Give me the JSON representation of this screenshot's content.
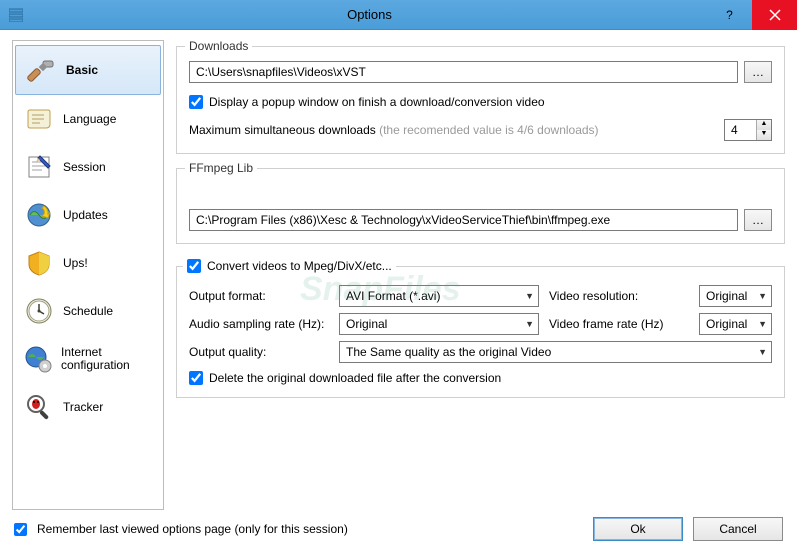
{
  "window": {
    "title": "Options",
    "help_tooltip": "?",
    "close_tooltip": "Close"
  },
  "sidebar": {
    "items": [
      {
        "label": "Basic"
      },
      {
        "label": "Language"
      },
      {
        "label": "Session"
      },
      {
        "label": "Updates"
      },
      {
        "label": "Ups!"
      },
      {
        "label": "Schedule"
      },
      {
        "label": "Internet configuration"
      },
      {
        "label": "Tracker"
      }
    ]
  },
  "downloads": {
    "legend": "Downloads",
    "path": "C:\\Users\\snapfiles\\Videos\\xVST",
    "popup_checked": true,
    "popup_label": "Display a popup window on finish a download/conversion video",
    "max_label": "Maximum simultaneous downloads",
    "max_hint": "(the recomended value is 4/6 downloads)",
    "max_value": "4"
  },
  "ffmpeg": {
    "legend": "FFmpeg Lib",
    "path": "C:\\Program Files (x86)\\Xesc & Technology\\xVideoServiceThief\\bin\\ffmpeg.exe"
  },
  "conversion": {
    "convert_checked": true,
    "convert_label": "Convert videos to Mpeg/DivX/etc...",
    "output_format_label": "Output format:",
    "output_format_value": "AVI Format (*.avi)",
    "video_res_label": "Video resolution:",
    "video_res_value": "Original",
    "audio_rate_label": "Audio sampling rate (Hz):",
    "audio_rate_value": "Original",
    "frame_rate_label": "Video frame rate (Hz)",
    "frame_rate_value": "Original",
    "quality_label": "Output quality:",
    "quality_value": "The Same quality as the original Video",
    "delete_checked": true,
    "delete_label": "Delete the original downloaded file after the conversion"
  },
  "footer": {
    "remember_checked": true,
    "remember_label": "Remember last viewed options page (only for this session)",
    "ok": "Ok",
    "cancel": "Cancel"
  },
  "watermark": "SnapFiles"
}
